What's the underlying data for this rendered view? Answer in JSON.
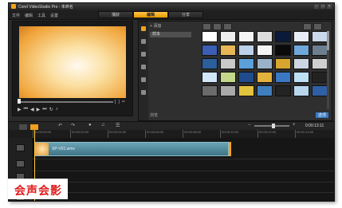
{
  "window": {
    "title": "Corel VideoStudio Pro - 未命名"
  },
  "menu": [
    "文件",
    "编辑",
    "工具",
    "设置"
  ],
  "steps": [
    {
      "label": "捕获",
      "active": false
    },
    {
      "label": "编辑",
      "active": true
    },
    {
      "label": "分享",
      "active": false
    }
  ],
  "library": {
    "add_label": "添加",
    "folder": "样本",
    "browse_label": "浏览",
    "options_label": "选项",
    "thumb_colors": [
      "#ffffff",
      "#eeeeee",
      "#f4f4f4",
      "#dddddd",
      "#0b1a3a",
      "#e9eef6",
      "#c9d8ea",
      "#3c5fb4",
      "#e7b656",
      "#bcd1ea",
      "#f4f4f4",
      "#0a0a0a",
      "#6fa8d8",
      "#6d7f8f",
      "#2a5f9c",
      "#c9c9c9",
      "#5ca0d9",
      "#9bb3c9",
      "#d8a62e",
      "#cdd7e3",
      "#cfcfcf",
      "#d2e7f7",
      "#c3d88a",
      "#1f4c8c",
      "#e3b23c",
      "#3b78c4",
      "#bde0f4",
      "#222222",
      "#6b6b6b",
      "#aaaaaa",
      "#e2c33f",
      "#3f7fc0",
      "#232323",
      "#b8d6ec",
      "#2f5fa4"
    ]
  },
  "timeline": {
    "timecode": "0:00:13:11",
    "ruler_labels": [
      "00:00:00:00",
      "00:00:02:00",
      "00:00:04:00",
      "00:00:06:00",
      "00:00:08:00",
      "00:00:10:00",
      "00:00:12:00",
      "00:00:14:00"
    ],
    "clip_name": "SP-V01.wmv"
  },
  "watermark": {
    "text": "会声会影"
  }
}
